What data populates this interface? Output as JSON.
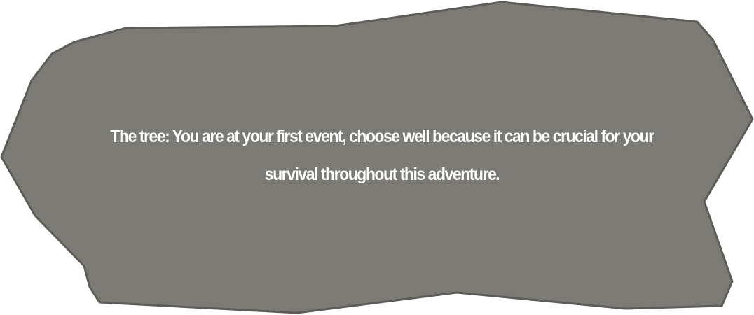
{
  "event_panel": {
    "text": "The tree: You are at your first event, choose well because it can be crucial for your survival throughout this adventure.",
    "fill_color": "#7b7a75",
    "border_color": "#5d5c58",
    "text_color": "#ffffff"
  }
}
